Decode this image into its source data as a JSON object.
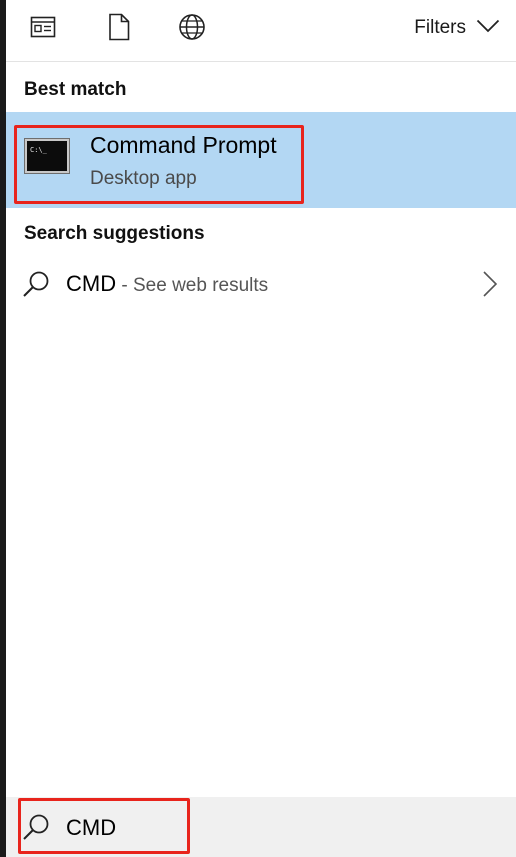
{
  "toolbar": {
    "icons": [
      "apps-icon",
      "documents-icon",
      "web-icon"
    ],
    "filters_label": "Filters"
  },
  "best_match": {
    "heading": "Best match",
    "app_name": "Command Prompt",
    "app_type": "Desktop app",
    "icon": "command-prompt-icon",
    "icon_text": "C:\\_"
  },
  "suggestions": {
    "heading": "Search suggestions",
    "items": [
      {
        "query": "CMD",
        "suffix": " - See web results"
      }
    ]
  },
  "search": {
    "value": "CMD"
  },
  "colors": {
    "selection": "#b3d7f3",
    "annotation": "#e8241c",
    "search_bar": "#f0f0f0"
  }
}
